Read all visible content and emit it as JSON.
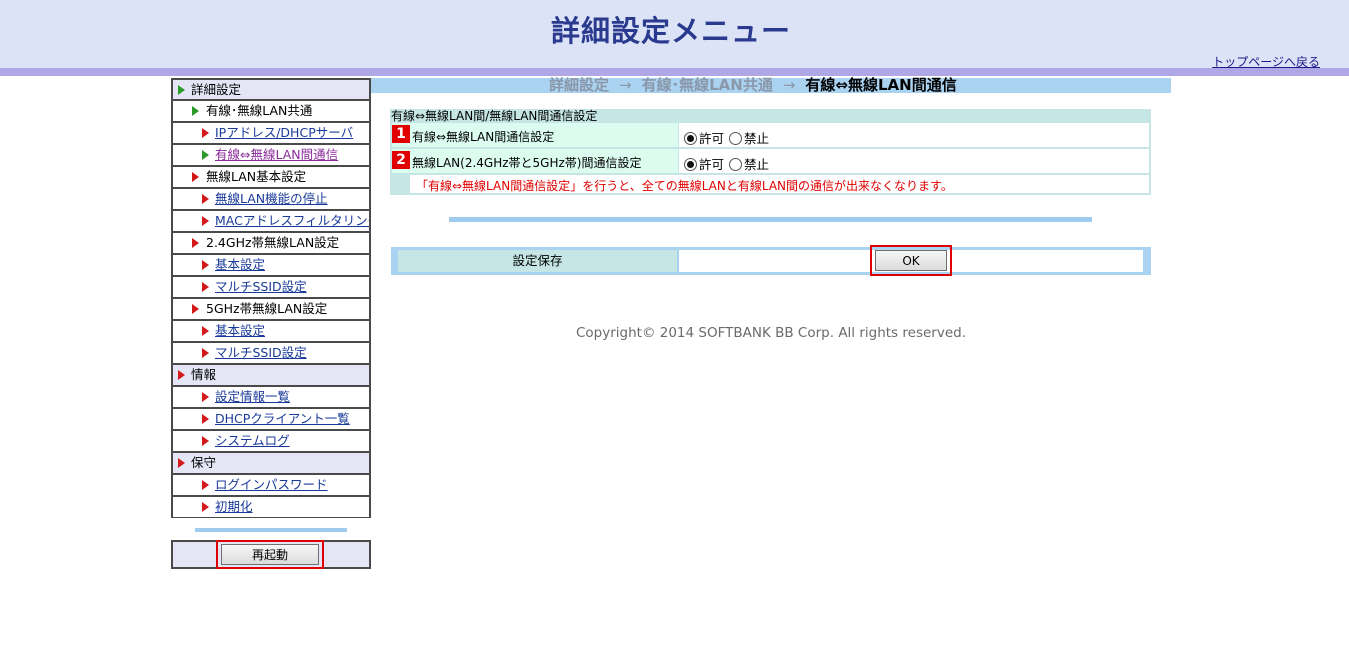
{
  "header": {
    "title": "詳細設定メニュー",
    "top_link": "トップページへ戻る"
  },
  "sidebar": {
    "items": [
      {
        "label": "詳細設定",
        "level": 0,
        "kind": "section",
        "icon": "green-triangle-icon"
      },
      {
        "label": "有線･無線LAN共通",
        "level": 1,
        "kind": "group",
        "icon": "green-triangle-icon"
      },
      {
        "label": "IPアドレス/DHCPサーバ",
        "level": 2,
        "kind": "link",
        "icon": "red-triangle-icon"
      },
      {
        "label": "有線⇔無線LAN間通信",
        "level": 2,
        "kind": "link-active",
        "icon": "green-triangle-icon"
      },
      {
        "label": "無線LAN基本設定",
        "level": 1,
        "kind": "group",
        "icon": "red-triangle-icon"
      },
      {
        "label": "無線LAN機能の停止",
        "level": 2,
        "kind": "link",
        "icon": "red-triangle-icon"
      },
      {
        "label": "MACアドレスフィルタリング",
        "level": 2,
        "kind": "link",
        "icon": "red-triangle-icon"
      },
      {
        "label": "2.4GHz帯無線LAN設定",
        "level": 1,
        "kind": "group",
        "icon": "red-triangle-icon"
      },
      {
        "label": "基本設定",
        "level": 2,
        "kind": "link",
        "icon": "red-triangle-icon"
      },
      {
        "label": "マルチSSID設定",
        "level": 2,
        "kind": "link",
        "icon": "red-triangle-icon"
      },
      {
        "label": "5GHz帯無線LAN設定",
        "level": 1,
        "kind": "group",
        "icon": "red-triangle-icon"
      },
      {
        "label": "基本設定",
        "level": 2,
        "kind": "link",
        "icon": "red-triangle-icon"
      },
      {
        "label": "マルチSSID設定",
        "level": 2,
        "kind": "link",
        "icon": "red-triangle-icon"
      },
      {
        "label": "情報",
        "level": 0,
        "kind": "section",
        "icon": "red-triangle-icon"
      },
      {
        "label": "設定情報一覧",
        "level": 2,
        "kind": "link",
        "icon": "red-triangle-icon"
      },
      {
        "label": "DHCPクライアント一覧",
        "level": 2,
        "kind": "link",
        "icon": "red-triangle-icon"
      },
      {
        "label": "システムログ",
        "level": 2,
        "kind": "link",
        "icon": "red-triangle-icon"
      },
      {
        "label": "保守",
        "level": 0,
        "kind": "section",
        "icon": "red-triangle-icon"
      },
      {
        "label": "ログインパスワード",
        "level": 2,
        "kind": "link",
        "icon": "red-triangle-icon"
      },
      {
        "label": "初期化",
        "level": 2,
        "kind": "link",
        "icon": "red-triangle-icon"
      }
    ],
    "reboot_label": "再起動"
  },
  "breadcrumb": {
    "part1": "詳細設定",
    "arrow": "→",
    "part2": "有線･無線LAN共通",
    "current": "有線⇔無線LAN間通信"
  },
  "settings": {
    "heading": "有線⇔無線LAN間/無線LAN間通信設定",
    "rows": [
      {
        "num": "1",
        "label": "有線⇔無線LAN間通信設定",
        "opt_allow": "許可",
        "opt_deny": "禁止",
        "selected": "allow"
      },
      {
        "num": "2",
        "label": "無線LAN(2.4GHz帯と5GHz帯)間通信設定",
        "opt_allow": "許可",
        "opt_deny": "禁止",
        "selected": "allow"
      }
    ],
    "warning": "「有線⇔無線LAN間通信設定」を行うと、全ての無線LANと有線LAN間の通信が出来なくなります。"
  },
  "save": {
    "label": "設定保存",
    "ok_label": "OK"
  },
  "footer": {
    "copyright": "Copyright© 2014 SOFTBANK BB Corp. All rights reserved."
  },
  "colors": {
    "header_bg": "#dde3f7",
    "header_bar": "#b0a8e6",
    "title": "#2a3a8f",
    "highlight": "#e00000",
    "table_head": "#c6e6e6",
    "breadcrumb_bg": "#aad3f2"
  }
}
